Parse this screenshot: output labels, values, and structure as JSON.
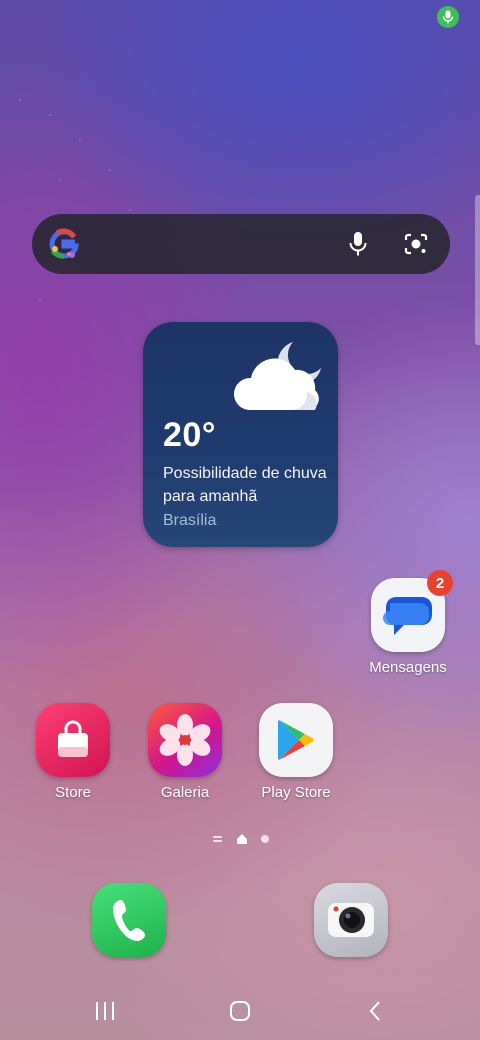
{
  "status": {
    "mic_indicator_color": "#3dbf5a"
  },
  "search_bar": {
    "logo_icon": "google-g-icon",
    "voice_icon": "microphone-icon",
    "lens_icon": "camera-lens-icon"
  },
  "weather": {
    "temperature": "20°",
    "description": "Possibilidade de chuva para amanhã",
    "city": "Brasília",
    "icon": "cloud-moon-icon"
  },
  "apps": {
    "messages": {
      "label": "Mensagens",
      "badge": "2",
      "icon": "messages-icon"
    },
    "store": {
      "label": "Store",
      "icon": "shopping-bag-icon"
    },
    "gallery": {
      "label": "Galeria",
      "icon": "flower-icon"
    },
    "play_store": {
      "label": "Play Store",
      "icon": "play-store-icon"
    }
  },
  "page_indicator": {
    "pages": [
      "list",
      "home",
      "page-2"
    ],
    "current": "home"
  },
  "dock": {
    "phone": {
      "icon": "phone-icon"
    },
    "camera": {
      "icon": "camera-icon"
    }
  },
  "navbar": {
    "recents_icon": "recents-icon",
    "home_icon": "home-icon",
    "back_icon": "back-icon"
  },
  "colors": {
    "weather_bg": "#1f3a6e",
    "badge": "#e8412d",
    "phone_green": "#2ecc5a"
  }
}
